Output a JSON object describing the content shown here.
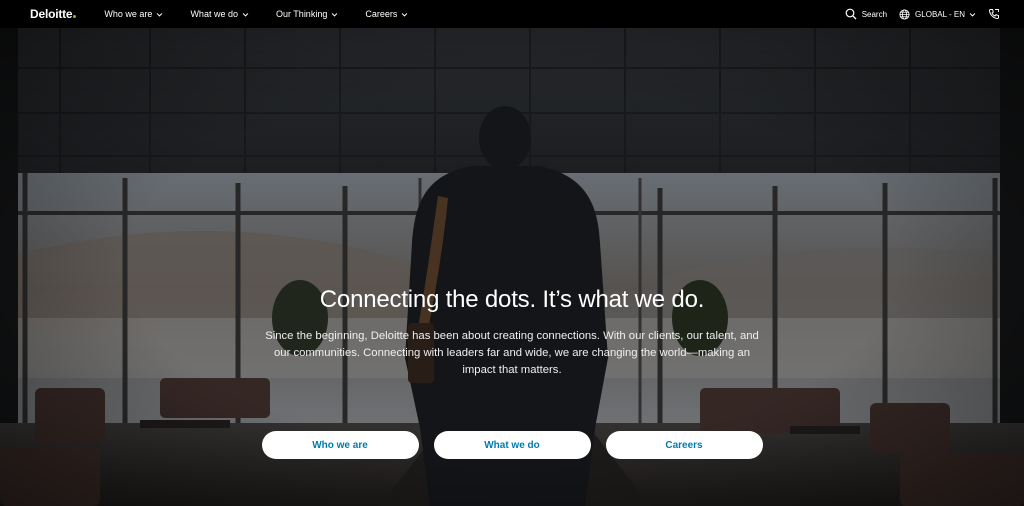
{
  "nav": {
    "logo": "Deloitte",
    "menu": [
      {
        "label": "Who we are"
      },
      {
        "label": "What we do"
      },
      {
        "label": "Our Thinking"
      },
      {
        "label": "Careers"
      }
    ],
    "search_label": "Search",
    "region_label": "GLOBAL - EN",
    "icons": {
      "search": "search-icon",
      "globe": "globe-icon",
      "contact": "phone-icon",
      "chevron": "chevron-down-icon"
    },
    "logo_dot_color": "#86bc25"
  },
  "hero": {
    "headline": "Connecting the dots. It’s what we do.",
    "description": "Since the beginning, Deloitte has been about creating connections. With our clients, our talent, and our communities. Connecting with leaders far and wide, we are changing the world—making an impact that matters.",
    "buttons": [
      {
        "label": "Who we are"
      },
      {
        "label": "What we do"
      },
      {
        "label": "Careers"
      }
    ],
    "button_text_color": "#007cb0"
  }
}
